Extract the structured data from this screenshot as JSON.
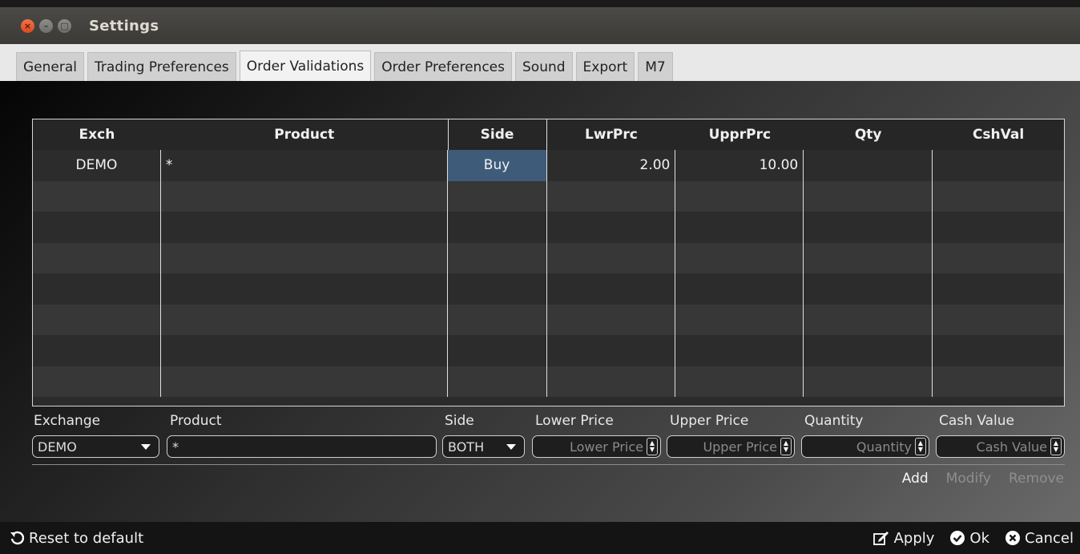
{
  "window": {
    "title": "Settings"
  },
  "tabs": [
    {
      "label": "General",
      "active": false
    },
    {
      "label": "Trading Preferences",
      "active": false
    },
    {
      "label": "Order Validations",
      "active": true
    },
    {
      "label": "Order Preferences",
      "active": false
    },
    {
      "label": "Sound",
      "active": false
    },
    {
      "label": "Export",
      "active": false
    },
    {
      "label": "M7",
      "active": false
    }
  ],
  "grid": {
    "columns": [
      "Exch",
      "Product",
      "Side",
      "LwrPrc",
      "UpprPrc",
      "Qty",
      "CshVal"
    ],
    "rows": [
      {
        "exch": "DEMO",
        "product": "*",
        "side": "Buy",
        "lwr": "2.00",
        "upr": "10.00",
        "qty": "",
        "csh": ""
      }
    ]
  },
  "editor": {
    "exchange": {
      "label": "Exchange",
      "value": "DEMO"
    },
    "product": {
      "label": "Product",
      "value": "*"
    },
    "side": {
      "label": "Side",
      "value": "BOTH"
    },
    "lower_price": {
      "label": "Lower Price",
      "placeholder": "Lower Price"
    },
    "upper_price": {
      "label": "Upper Price",
      "placeholder": "Upper Price"
    },
    "quantity": {
      "label": "Quantity",
      "placeholder": "Quantity"
    },
    "cash_value": {
      "label": "Cash Value",
      "placeholder": "Cash Value"
    }
  },
  "actions": {
    "add": "Add",
    "modify": "Modify",
    "remove": "Remove"
  },
  "footer": {
    "reset": "Reset to default",
    "apply": "Apply",
    "ok": "Ok",
    "cancel": "Cancel"
  },
  "colors": {
    "selected_cell": "#3e5c7a",
    "close_button": "#e95420"
  }
}
